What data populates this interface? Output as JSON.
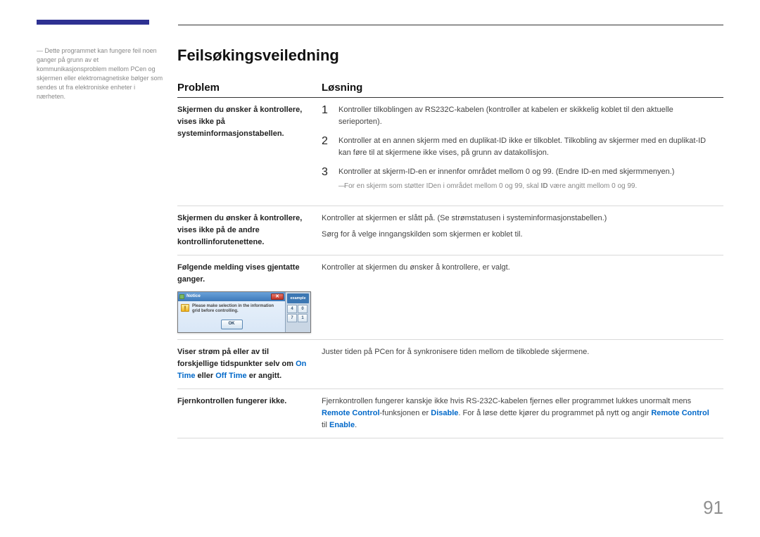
{
  "accent_color": "#2e3192",
  "link_color": "#0068c9",
  "page_number": "91",
  "sidebar_note": "Dette programmet kan fungere feil noen ganger på grunn av et kommunikasjonsproblem mellom PCen og skjermen eller elektromagnetiske bølger som sendes ut fra elektroniske enheter i nærheten.",
  "title": "Feilsøkingsveiledning",
  "headers": {
    "problem": "Problem",
    "solution": "Løsning"
  },
  "rows": {
    "r1": {
      "problem": "Skjermen du ønsker å kontrollere, vises ikke på systeminformasjonstabellen.",
      "steps": {
        "s1": "Kontroller tilkoblingen av RS232C-kabelen (kontroller at kabelen er skikkelig koblet til den aktuelle serieporten).",
        "s2": "Kontroller at en annen skjerm med en duplikat-ID ikke er tilkoblet. Tilkobling av skjermer med en duplikat-ID kan føre til at skjermene ikke vises, på grunn av datakollisjon.",
        "s3": "Kontroller at skjerm-ID-en er innenfor området mellom 0 og 99. (Endre ID-en med skjermmenyen.)"
      },
      "note_pre": "For en skjerm som støtter IDen i området mellom 0 og 99, skal ",
      "note_bold": "ID",
      "note_post": " være angitt mellom 0 og 99."
    },
    "r2": {
      "problem": "Skjermen du ønsker å kontrollere, vises ikke på de andre kontrollinforutenettene.",
      "sol1": "Kontroller at skjermen er slått på. (Se strømstatusen i systeminformasjonstabellen.)",
      "sol2": "Sørg for å velge inngangskilden som skjermen er koblet til."
    },
    "r3": {
      "problem": "Følgende melding vises gjentatte ganger.",
      "solution": "Kontroller at skjermen du ønsker å kontrollere, er valgt.",
      "dialog": {
        "title": "Notice",
        "message": "Please make selection in the information grid before controlling.",
        "ok": "OK",
        "example": "example",
        "cells": {
          "a": "4",
          "b": "0",
          "c": "7",
          "d": "1"
        }
      }
    },
    "r4": {
      "problem_pre": "Viser strøm på eller av til forskjellige tidspunkter selv om ",
      "on_time": "On Time",
      "mid": " eller ",
      "off_time": "Off Time",
      "problem_post": " er angitt.",
      "solution": "Juster tiden på PCen for å synkronisere tiden mellom de tilkoblede skjermene."
    },
    "r5": {
      "problem": "Fjernkontrollen fungerer ikke.",
      "sol_pre": "Fjernkontrollen fungerer kanskje ikke hvis RS-232C-kabelen fjernes eller programmet lukkes unormalt mens ",
      "kw1": "Remote Control",
      "mid1": "-funksjonen er ",
      "kw2": "Disable",
      "mid2": ". For å løse dette kjører du programmet på nytt og angir ",
      "kw3": "Remote Control",
      "mid3": " til ",
      "kw4": "Enable",
      "end": "."
    }
  }
}
